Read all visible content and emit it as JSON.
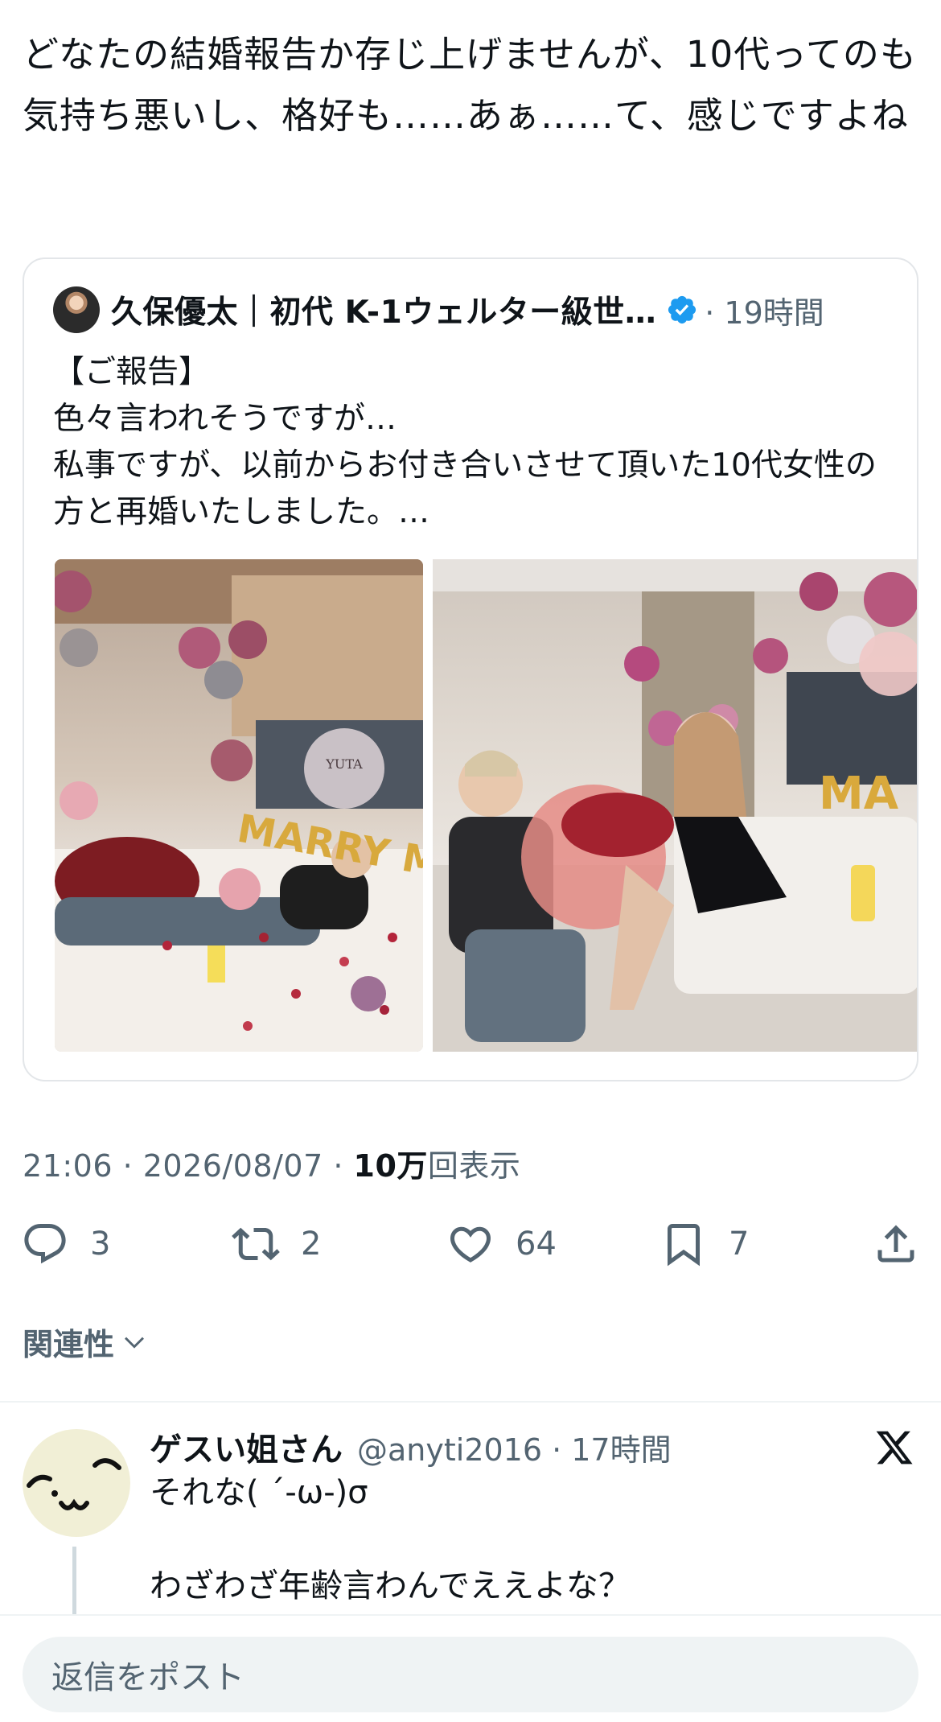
{
  "post": {
    "text": "どなたの結婚報告か存じ上げませんが、10代ってのも気持ち悪いし、格好も……あぁ……て、感じですよね",
    "timestamp": "21:06 · 2026/08/07 · ",
    "views_count": "10万",
    "views_label": "回表示"
  },
  "quoted": {
    "author": "久保優太｜初代 K-1ウェルター級世…",
    "time": "· 19時間",
    "text": "【ご報告】\n色々言われそうですが…\n私事ですが、以前からお付き合いさせて頂いた10代女性の方と再婚いたしました。…",
    "photo_text": [
      "YUTA",
      "MARRY ME?",
      "MA"
    ]
  },
  "actions": {
    "replies": "3",
    "reposts": "2",
    "likes": "64",
    "bookmarks": "7"
  },
  "sort": {
    "label": "関連性"
  },
  "reply": {
    "name": "ゲスい姐さん",
    "handle": "@anyti2016 · 17時間",
    "text": "それな( ´-ω-)σ\n\nわざわざ年齢言わんでええよな？"
  },
  "compose": {
    "placeholder": "返信をポスト"
  },
  "colors": {
    "accent": "#1d9bf0",
    "secondary_text": "#536471",
    "border": "#e3e6e9"
  }
}
